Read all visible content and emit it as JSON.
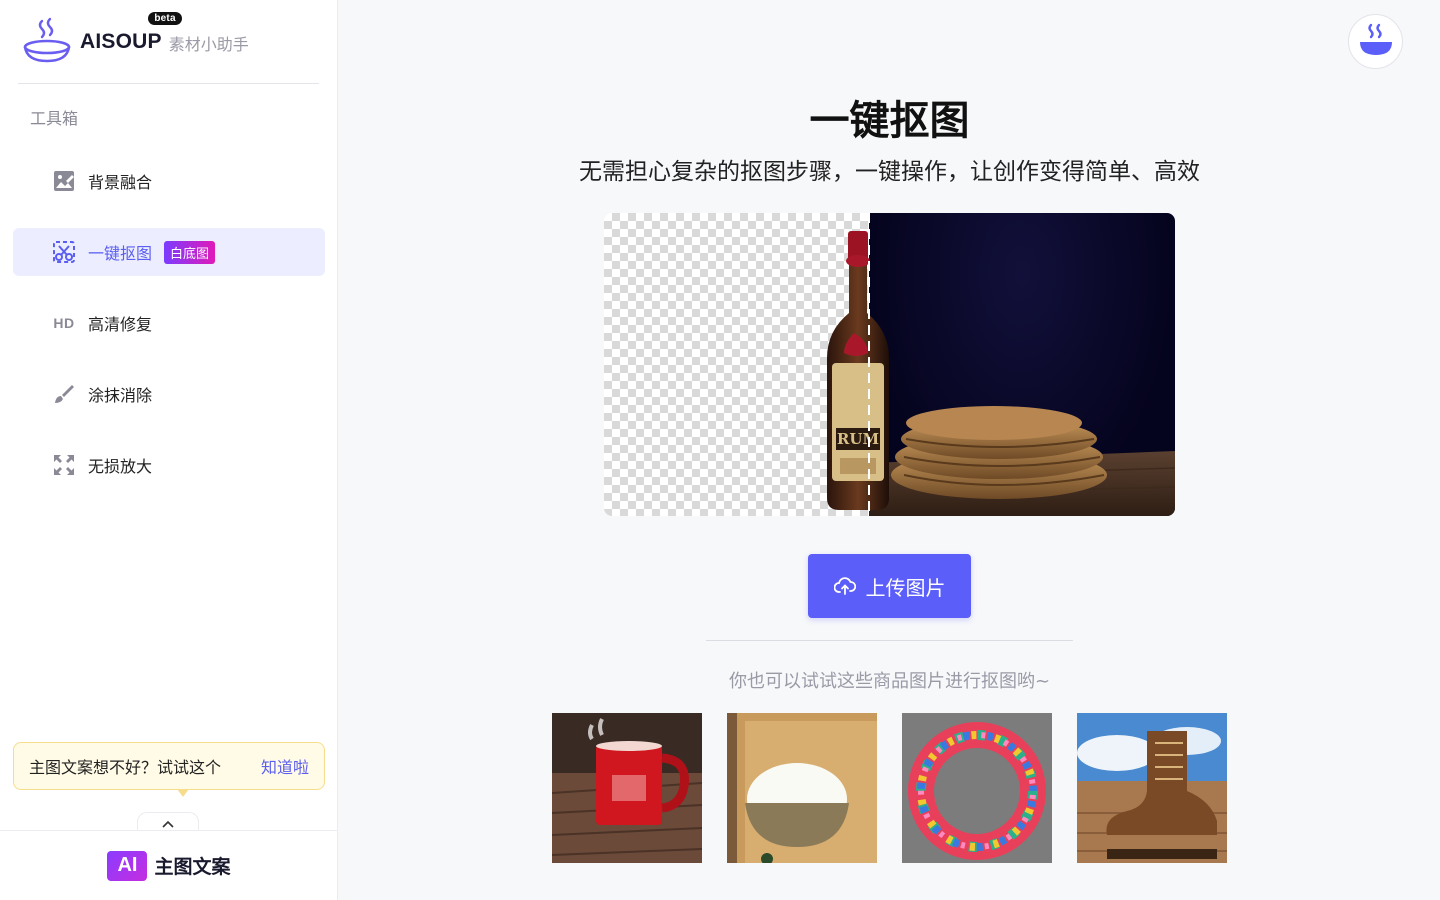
{
  "brand": {
    "name": "AISOUP",
    "beta": "beta",
    "subtitle": "素材小助手"
  },
  "sidebar": {
    "section_title": "工具箱",
    "items": [
      {
        "label": "背景融合",
        "icon": "image-edit-icon"
      },
      {
        "label": "一键抠图",
        "icon": "scissors-icon",
        "badge": "白底图",
        "active": true
      },
      {
        "label": "高清修复",
        "icon": "hd-icon",
        "icon_text": "HD"
      },
      {
        "label": "涂抹消除",
        "icon": "brush-icon"
      },
      {
        "label": "无损放大",
        "icon": "expand-icon"
      }
    ],
    "tip": {
      "text": "主图文案想不好？试试这个",
      "action": "知道啦"
    },
    "bottom": {
      "badge": "AI",
      "label": "主图文案"
    }
  },
  "main": {
    "title": "一键抠图",
    "subtitle": "无需担心复杂的抠图步骤，一键操作，让创作变得简单、高效",
    "demo_bottle_label": "RUM",
    "upload_label": "上传图片",
    "hint": "你也可以试试这些商品图片进行抠图哟~",
    "samples": [
      {
        "name": "red-mug"
      },
      {
        "name": "rice-bowl"
      },
      {
        "name": "flower-wreath"
      },
      {
        "name": "leather-boot"
      }
    ]
  },
  "colors": {
    "accent": "#5b5ef8",
    "active_bg": "#eceeff",
    "tip_bg": "#fffbe6"
  }
}
